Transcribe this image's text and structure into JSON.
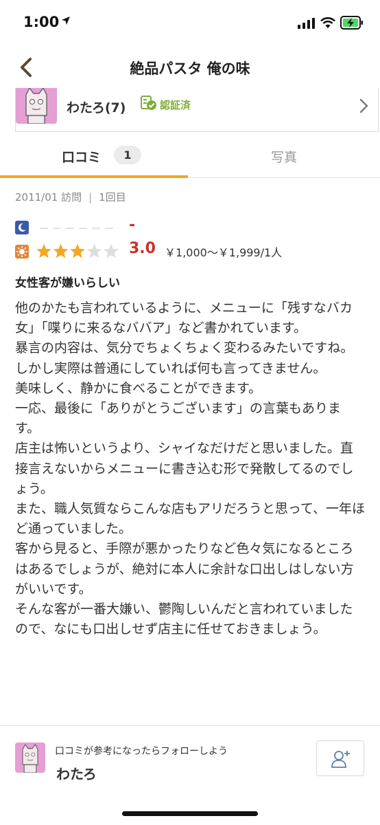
{
  "status_bar": {
    "time": "1:00"
  },
  "nav": {
    "title": "絶品パスタ 俺の味"
  },
  "reviewer": {
    "name": "わたろ(7)",
    "verified_label": "認証済"
  },
  "tabs": [
    {
      "label": "口コミ",
      "badge": "1",
      "active": true
    },
    {
      "label": "写真",
      "active": false
    }
  ],
  "visit": {
    "date": "2011/01 訪問",
    "separator": "|",
    "count": "1回目"
  },
  "ratings": {
    "dinner": {
      "icon": "moon-icon",
      "stars_text": "－－－－－－",
      "score": "-"
    },
    "lunch": {
      "icon": "sun-icon",
      "stars": 3,
      "max_stars": 5,
      "score": "3.0",
      "price": "￥1,000～￥1,999/1人"
    }
  },
  "review": {
    "title": "女性客が嫌いらしい",
    "paragraphs": [
      "他のかたも言われているように、メニューに「残すなバカ女」「喋りに来るなババア」など書かれています。",
      "暴言の内容は、気分でちょくちょく変わるみたいですね。",
      "しかし実際は普通にしていれば何も言ってきません。",
      "美味しく、静かに食べることができます。",
      "一応、最後に「ありがとうございます」の言葉もあります。",
      "店主は怖いというより、シャイなだけだと思いました。直接言えないからメニューに書き込む形で発散してるのでしょう。",
      "また、職人気質ならこんな店もアリだろうと思って、一年ほど通っていました。",
      "客から見ると、手際が悪かったりなど色々気になるところはあるでしょうが、絶対に本人に余計な口出しはしない方がいいです。",
      "そんな客が一番大嫌い、鬱陶しいんだと言われていましたので、なにも口出しせず店主に任せておきましょう。"
    ]
  },
  "follow": {
    "prompt": "口コミが参考になったらフォローしよう",
    "name": "わたろ"
  },
  "colors": {
    "accent": "#f5a623",
    "score": "#c8342a",
    "verified": "#7fae3a",
    "avatar": "#e59fd5"
  }
}
